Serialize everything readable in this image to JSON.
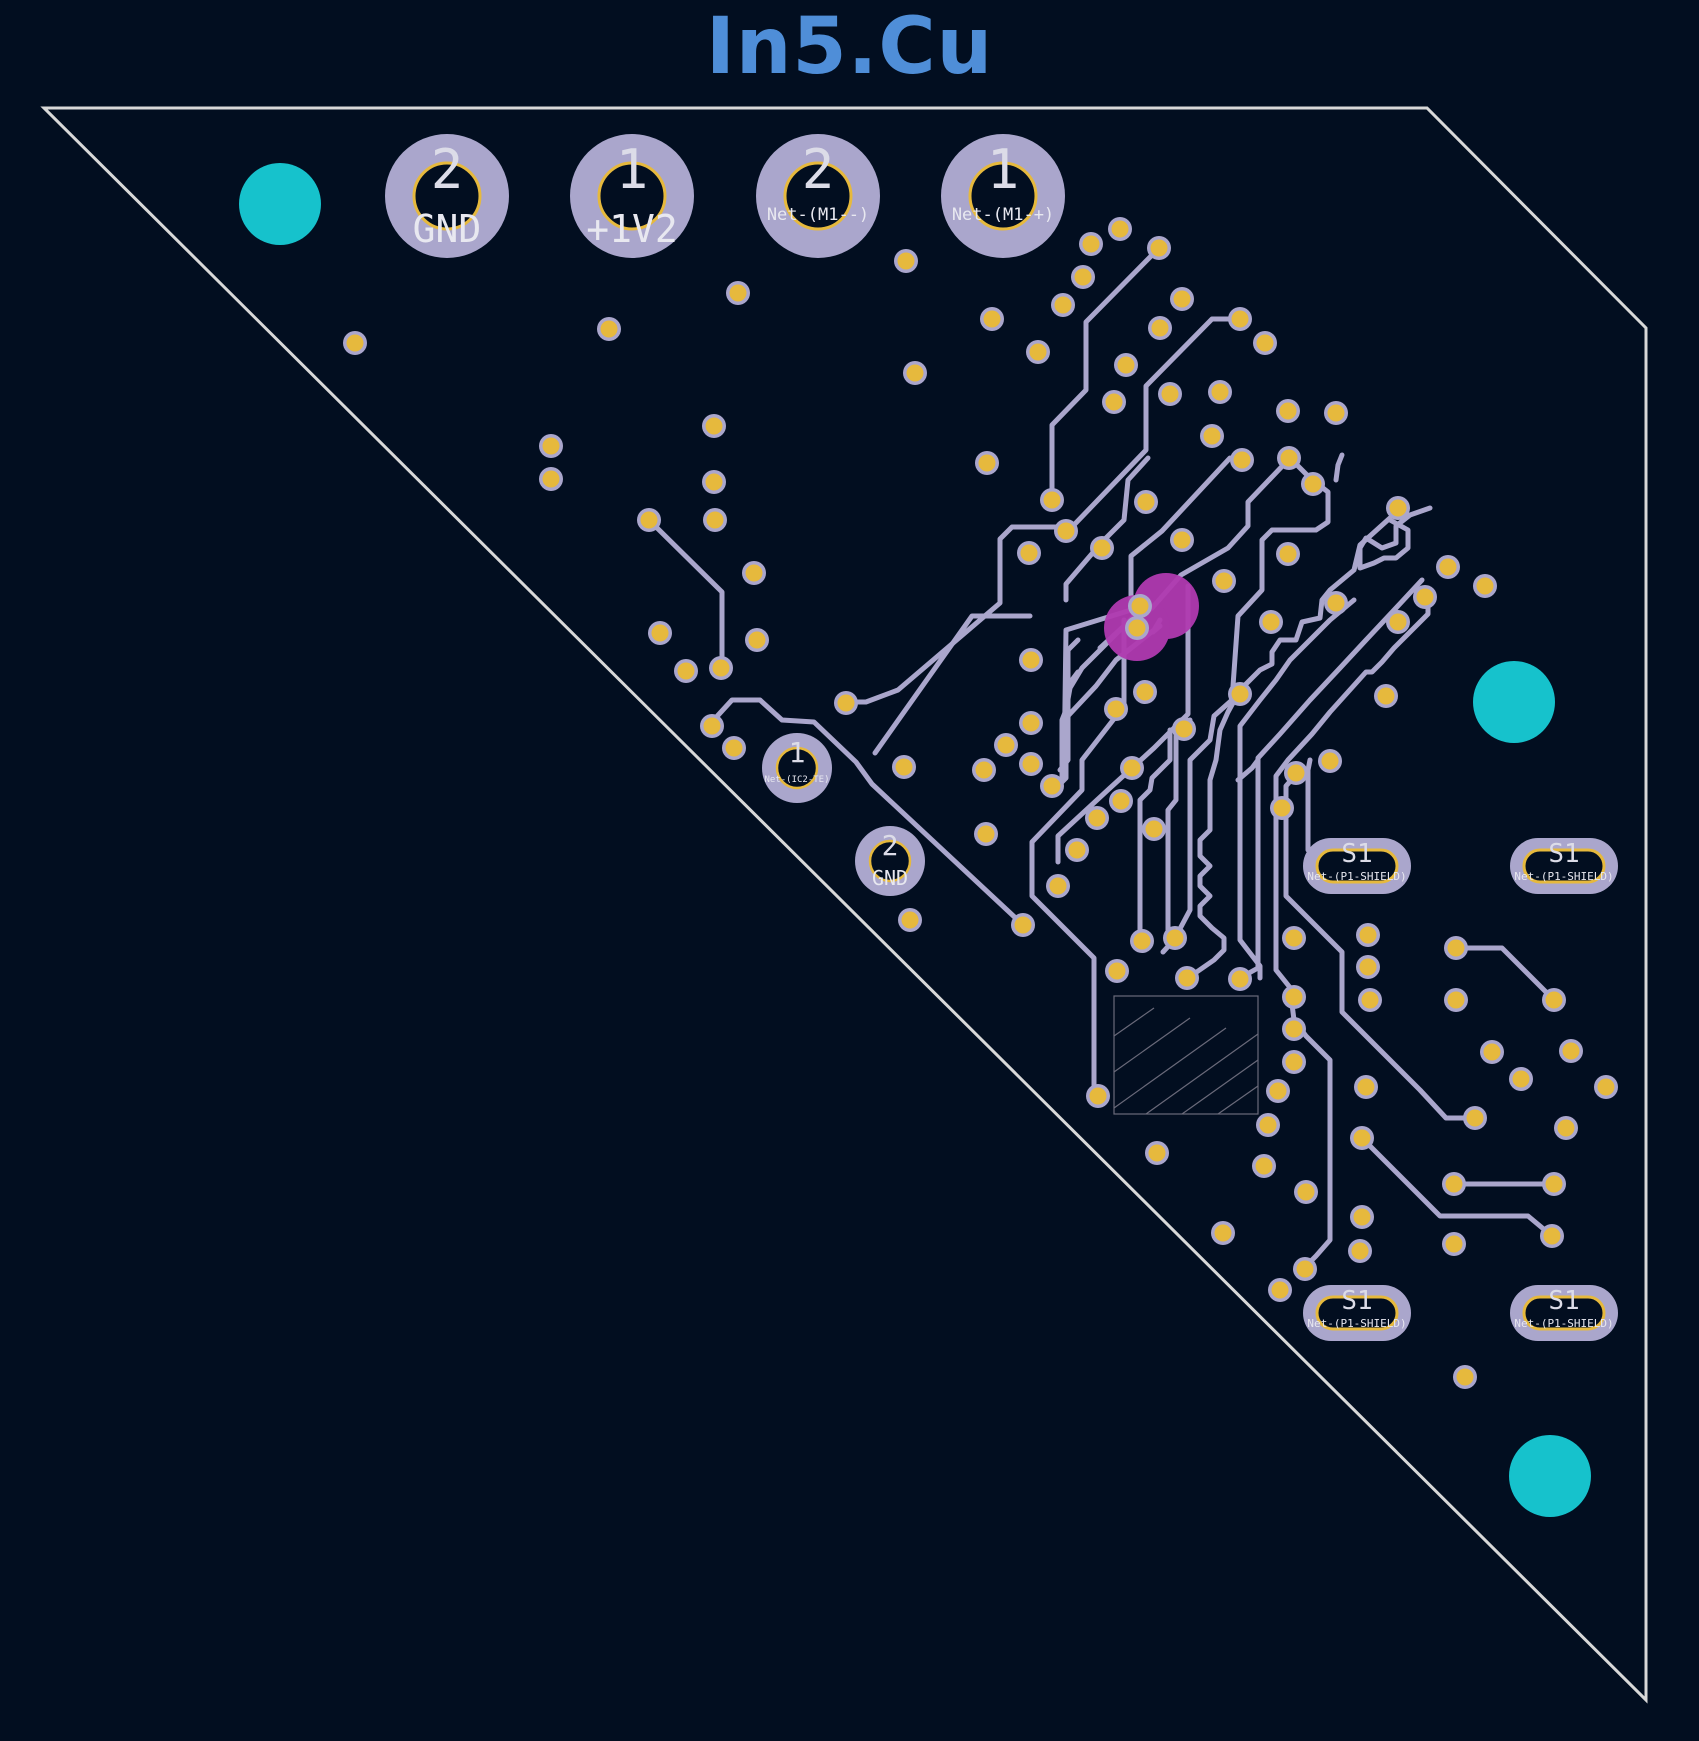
{
  "layer_name": "In5.Cu",
  "colors": {
    "background": "#020e20",
    "title": "#4f8ed8",
    "board_outline": "#d8d8d8",
    "track": "#aaa6cc",
    "pad_ring": "#aaa6cc",
    "via_fill": "#e6b93d",
    "drill_outline": "#e6b93d",
    "mounting_hole": "#16c2cc",
    "highlight": "#b03ab0"
  },
  "big_pads": [
    {
      "num": "2",
      "net": "GND"
    },
    {
      "num": "1",
      "net": "+1V2"
    },
    {
      "num": "2",
      "net": "Net-(M1--)"
    },
    {
      "num": "1",
      "net": "Net-(M1-+)"
    }
  ],
  "small_pads": [
    {
      "num": "1",
      "net": "Net-(IC2-TE)"
    },
    {
      "num": "2",
      "net": "GND"
    }
  ],
  "shield_pads": [
    {
      "num": "S1",
      "net": "Net-(P1-SHIELD)"
    },
    {
      "num": "S1",
      "net": "Net-(P1-SHIELD)"
    },
    {
      "num": "S1",
      "net": "Net-(P1-SHIELD)"
    },
    {
      "num": "S1",
      "net": "Net-(P1-SHIELD)"
    }
  ]
}
